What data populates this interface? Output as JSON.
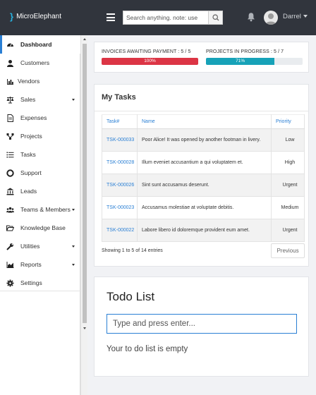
{
  "app": {
    "mark": "}",
    "name": "MicroElephant"
  },
  "header": {
    "search_placeholder": "Search anything. note: use",
    "username": "Darrel"
  },
  "sidebar": {
    "items": [
      {
        "label": "Dashboard",
        "icon": "dashboard-icon",
        "active": true
      },
      {
        "label": "Customers",
        "icon": "user-icon"
      },
      {
        "label": "Vendors",
        "icon": "chart-icon"
      },
      {
        "label": "Sales",
        "icon": "balance-scale-icon",
        "has_submenu": true
      },
      {
        "label": "Expenses",
        "icon": "file-icon"
      },
      {
        "label": "Projects",
        "icon": "sitemap-icon"
      },
      {
        "label": "Tasks",
        "icon": "list-icon"
      },
      {
        "label": "Support",
        "icon": "life-ring-icon"
      },
      {
        "label": "Leads",
        "icon": "bank-icon"
      },
      {
        "label": "Teams & Members",
        "icon": "users-icon",
        "has_submenu": true
      },
      {
        "label": "Knowledge Base",
        "icon": "folder-open-icon"
      },
      {
        "label": "Utilities",
        "icon": "wrench-icon",
        "has_submenu": true
      },
      {
        "label": "Reports",
        "icon": "area-chart-icon",
        "has_submenu": true
      },
      {
        "label": "Settings",
        "icon": "gear-icon"
      }
    ]
  },
  "stats": {
    "invoices": {
      "label": "INVOICES AWAITING PAYMENT : 5 / 5",
      "percent_text": "100%",
      "fraction": 1.0,
      "color": "#dc3545"
    },
    "projects": {
      "label": "PROJECTS IN PROGRESS : 5 / 7",
      "percent_text": "71%",
      "fraction": 0.71,
      "color": "#17a2b8"
    }
  },
  "tasks": {
    "title": "My Tasks",
    "columns": [
      "Task#",
      "Name",
      "Priority"
    ],
    "rows": [
      {
        "id": "TSK-000033",
        "name": "Poor Alice! It was opened by another footman in livery.",
        "priority": "Low"
      },
      {
        "id": "TSK-000028",
        "name": "Illum eveniet accusantium a qui voluptatem et.",
        "priority": "High"
      },
      {
        "id": "TSK-000026",
        "name": "Sint sunt accusamus deserunt.",
        "priority": "Urgent"
      },
      {
        "id": "TSK-000023",
        "name": "Accusamus molestiae at voluptate debitis.",
        "priority": "Medium"
      },
      {
        "id": "TSK-000022",
        "name": "Labore libero id doloremque provident eum amet.",
        "priority": "Urgent"
      }
    ],
    "info": "Showing 1 to 5 of 14 entries",
    "prev_label": "Previous"
  },
  "todo": {
    "title": "Todo List",
    "placeholder": "Type and press enter...",
    "empty_text": "Your to do list is empty"
  },
  "colors": {
    "topbar": "#31353d",
    "accent": "#2a7fd4"
  }
}
